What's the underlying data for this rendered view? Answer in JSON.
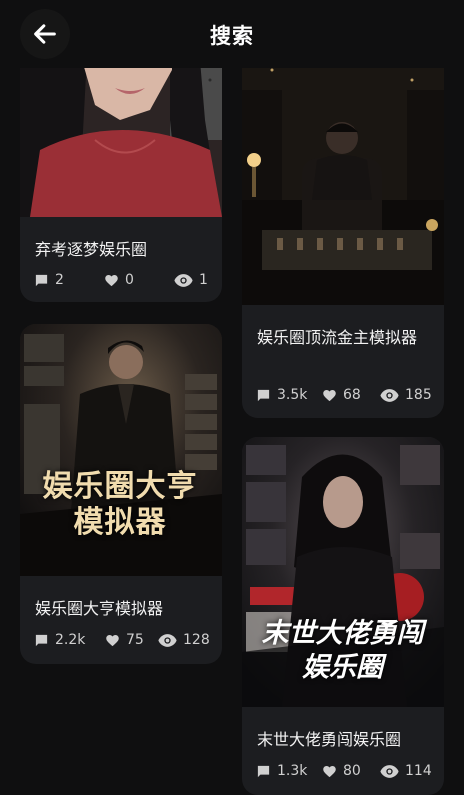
{
  "header": {
    "title": "搜索",
    "back_icon": "arrow-left-icon"
  },
  "colors": {
    "background": "#0f0f10",
    "card": "#1c1d20",
    "text": "#f2f2f2",
    "muted": "#d0d0d0"
  },
  "cards": [
    {
      "title": "弃考逐梦娱乐圈",
      "comments": "2",
      "likes": "0",
      "views": "1"
    },
    {
      "title": "娱乐圈顶流金主模拟器",
      "comments": "3.5k",
      "likes": "68",
      "views": "185"
    },
    {
      "title": "娱乐圈大亨模拟器",
      "cover_text": "娱乐圈大亨模拟器",
      "comments": "2.2k",
      "likes": "75",
      "views": "128"
    },
    {
      "title": "末世大佬勇闯娱乐圈",
      "cover_text": "末世大佬勇闯娱乐圈",
      "comments": "1.3k",
      "likes": "80",
      "views": "114"
    }
  ]
}
